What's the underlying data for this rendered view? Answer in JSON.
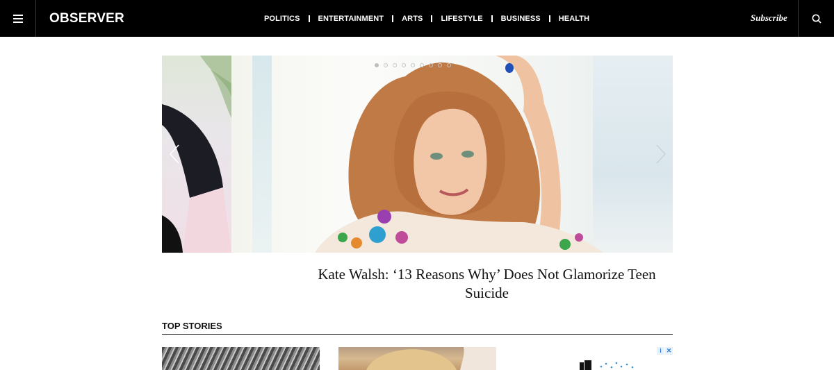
{
  "header": {
    "logo": "OBSERVER",
    "nav": [
      "POLITICS",
      "ENTERTAINMENT",
      "ARTS",
      "LIFESTYLE",
      "BUSINESS",
      "HEALTH"
    ],
    "subscribe": "Subscribe",
    "icons": {
      "menu": "hamburger-menu-icon",
      "search": "search-icon"
    }
  },
  "hero": {
    "slide_count": 9,
    "active_slide": 1,
    "headline": "Kate Walsh: ‘13 Reasons Why’ Does Not Glamorize Teen Suicide",
    "icons": {
      "prev": "chevron-left-icon",
      "next": "chevron-right-icon"
    }
  },
  "top_stories": {
    "title": "TOP STORIES"
  },
  "ad": {
    "badge_icons": [
      "adchoices-icon",
      "close-icon"
    ]
  },
  "colors": {
    "header_bg": "#000000",
    "page_bg": "#ffffff",
    "text": "#111111"
  }
}
